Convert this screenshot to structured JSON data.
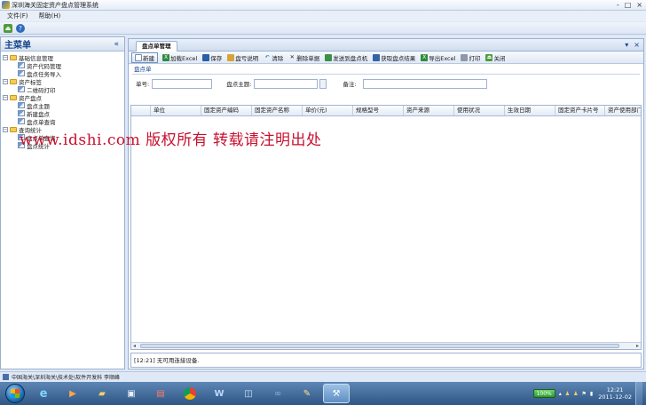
{
  "window": {
    "title": "深圳海关固定资产盘点管理系统",
    "controls": [
      "-",
      "□",
      "×"
    ]
  },
  "menu": {
    "items": [
      "文件(F)",
      "帮助(H)"
    ]
  },
  "sidebar": {
    "title": "主菜单",
    "collapse": "«",
    "tree": [
      {
        "label": "基础信息管理",
        "level": 1,
        "type": "folder"
      },
      {
        "label": "资产代码管理",
        "level": 2,
        "type": "leaf"
      },
      {
        "label": "盘点任务导入",
        "level": 2,
        "type": "leaf"
      },
      {
        "label": "资产标签",
        "level": 1,
        "type": "folder"
      },
      {
        "label": "二维码打印",
        "level": 2,
        "type": "leaf"
      },
      {
        "label": "资产盘点",
        "level": 1,
        "type": "folder"
      },
      {
        "label": "盘点主题",
        "level": 2,
        "type": "leaf"
      },
      {
        "label": "新建盘点",
        "level": 2,
        "type": "leaf"
      },
      {
        "label": "盘点单查询",
        "level": 2,
        "type": "leaf"
      },
      {
        "label": "查询统计",
        "level": 1,
        "type": "folder"
      },
      {
        "label": "盘点单查询",
        "level": 2,
        "type": "leaf"
      },
      {
        "label": "盘点统计",
        "level": 2,
        "type": "leaf"
      }
    ]
  },
  "tab": {
    "label": "盘点单管理",
    "controls": [
      "▾",
      "×"
    ]
  },
  "toolbar": {
    "buttons": [
      "新建",
      "加载Excel",
      "保存",
      "盘亏说明",
      "清除",
      "删除单据",
      "发送到盘点机",
      "获取盘点结果",
      "导出Excel",
      "打印",
      "关闭"
    ]
  },
  "form": {
    "section": "盘点单",
    "doc_no_label": "单号:",
    "subject_label": "盘点主题:",
    "remark_label": "备注:"
  },
  "grid": {
    "columns": [
      "单位",
      "固定资产编码",
      "固定资产名称",
      "单价(元)",
      "规格型号",
      "资产来源",
      "使用状况",
      "生效日期",
      "固定资产卡片号",
      "资产使用部门"
    ]
  },
  "log": {
    "text": "[12:21] 无可用连接设备."
  },
  "watermark": {
    "text": "www.idshi.com  版权所有 转载请注明出处"
  },
  "status": {
    "text": "中国海关\\深圳海关\\技术处\\软件开发科 李顺峰"
  },
  "taskbar": {
    "battery": "100%",
    "time": "12:21",
    "date": "2011-12-02"
  },
  "colors": {
    "accent": "#15428b",
    "watermark": "#c8102e"
  }
}
